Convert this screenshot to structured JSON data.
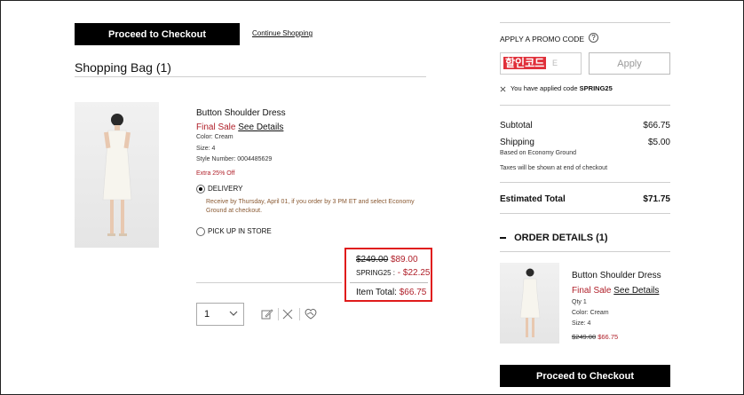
{
  "left": {
    "checkout_label": "Proceed to Checkout",
    "continue_label": "Continue Shopping",
    "bag_title": "Shopping Bag (1)"
  },
  "item": {
    "name": "Button Shoulder Dress",
    "final_sale": "Final Sale",
    "see_details": "See Details",
    "color": "Color: Cream",
    "size": "Size: 4",
    "style_number": "Style Number: 0004485629",
    "promo_note": "Extra 25% Off",
    "delivery_label": "DELIVERY",
    "delivery_note": "Receive by Thursday, April 01, if you order by 3 PM ET and select Economy Ground at checkout.",
    "pickup_label": "PICK UP IN STORE",
    "original_price": "$249.00",
    "sale_price": "$89.00",
    "promo_code_label": "SPRING25 :",
    "promo_discount": "- $22.25",
    "item_total_label": "Item Total:",
    "item_total_value": "$66.75",
    "qty_value": "1"
  },
  "summary": {
    "promo_title": "APPLY A PROMO CODE",
    "promo_input_overlay": "할인코드",
    "promo_input_ghost": "E",
    "apply_label": "Apply",
    "applied_prefix": "You have applied code",
    "applied_code": "SPRING25",
    "subtotal_label": "Subtotal",
    "subtotal_value": "$66.75",
    "shipping_label": "Shipping",
    "shipping_value": "$5.00",
    "shipping_method": "Based on Economy Ground",
    "tax_note": "Taxes will be shown at end of checkout",
    "estimated_label": "Estimated Total",
    "estimated_value": "$71.75",
    "order_details_title": "ORDER DETAILS (1)",
    "od_name": "Button Shoulder Dress",
    "od_final_sale": "Final Sale",
    "od_see_details": "See Details",
    "od_qty": "Qty 1",
    "od_color": "Color: Cream",
    "od_size": "Size: 4",
    "od_original": "$249.00",
    "od_sale": "$66.75",
    "checkout_label": "Proceed to Checkout"
  },
  "colors": {
    "sale_red": "#b0202a",
    "highlight_box": "#e01b1b",
    "delivery_text": "#8a5a33"
  }
}
